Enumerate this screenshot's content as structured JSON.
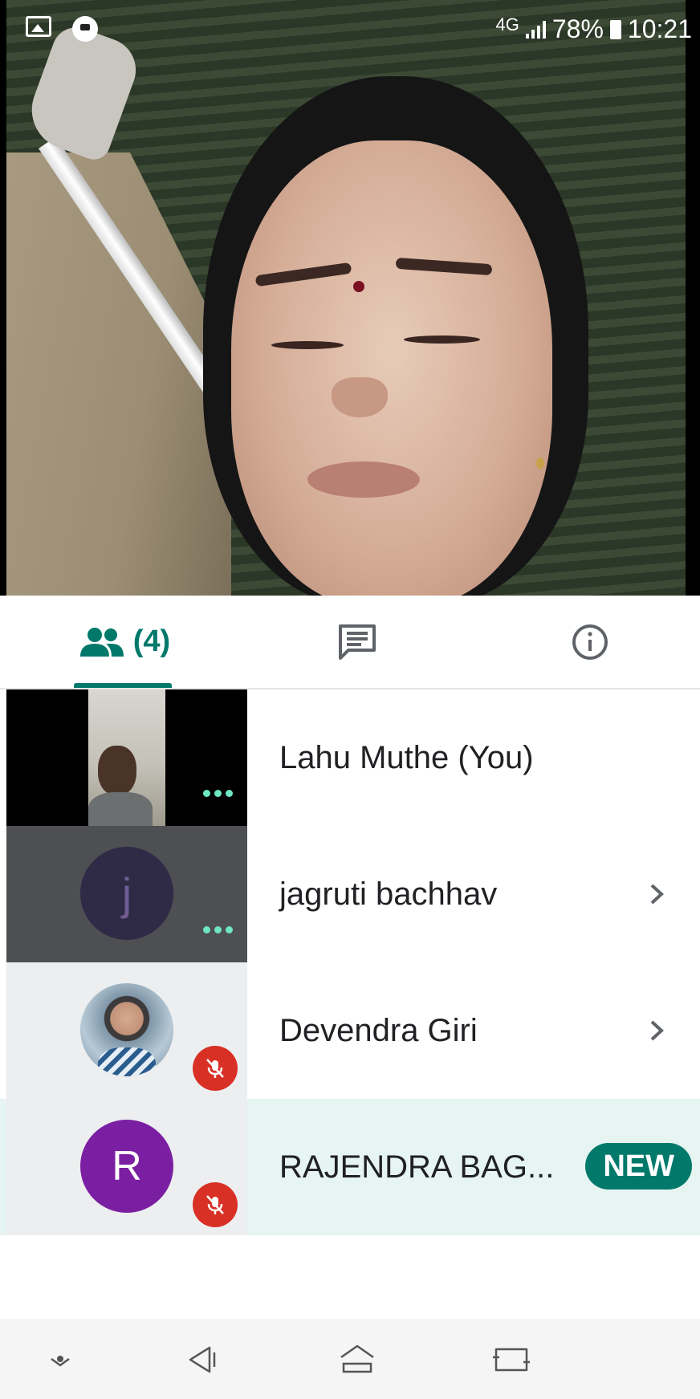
{
  "status_bar": {
    "network": "4G",
    "battery": "78%",
    "time": "10:21",
    "left_icons": [
      "gallery-icon",
      "chat-bubble-icon"
    ]
  },
  "tabs": {
    "people_count": "(4)",
    "items": [
      "people-icon",
      "chat-icon",
      "info-icon"
    ],
    "active": "people",
    "accent_color": "#00796b"
  },
  "participants": [
    {
      "name": "Lahu Muthe (You)",
      "tile": "camera",
      "more": true,
      "chevron": false
    },
    {
      "name": "jagruti bachhav",
      "tile": "initial",
      "initial": "j",
      "avatar_color": "#2f2a45",
      "more": true,
      "chevron": true
    },
    {
      "name": "Devendra Giri",
      "tile": "photo",
      "muted": true,
      "chevron": true
    },
    {
      "name": "RAJENDRA BAG...",
      "tile": "initial",
      "initial": "R",
      "avatar_color": "#7b1fa2",
      "muted": true,
      "badge": "NEW",
      "highlighted": true
    }
  ],
  "colors": {
    "mute_red": "#d93025",
    "new_row_bg": "#e6f4f2",
    "dots_green": "#6ee6c2"
  },
  "nav_bar": {
    "buttons": [
      "notification-dot-icon",
      "back-icon",
      "home-icon",
      "recents-icon"
    ]
  }
}
